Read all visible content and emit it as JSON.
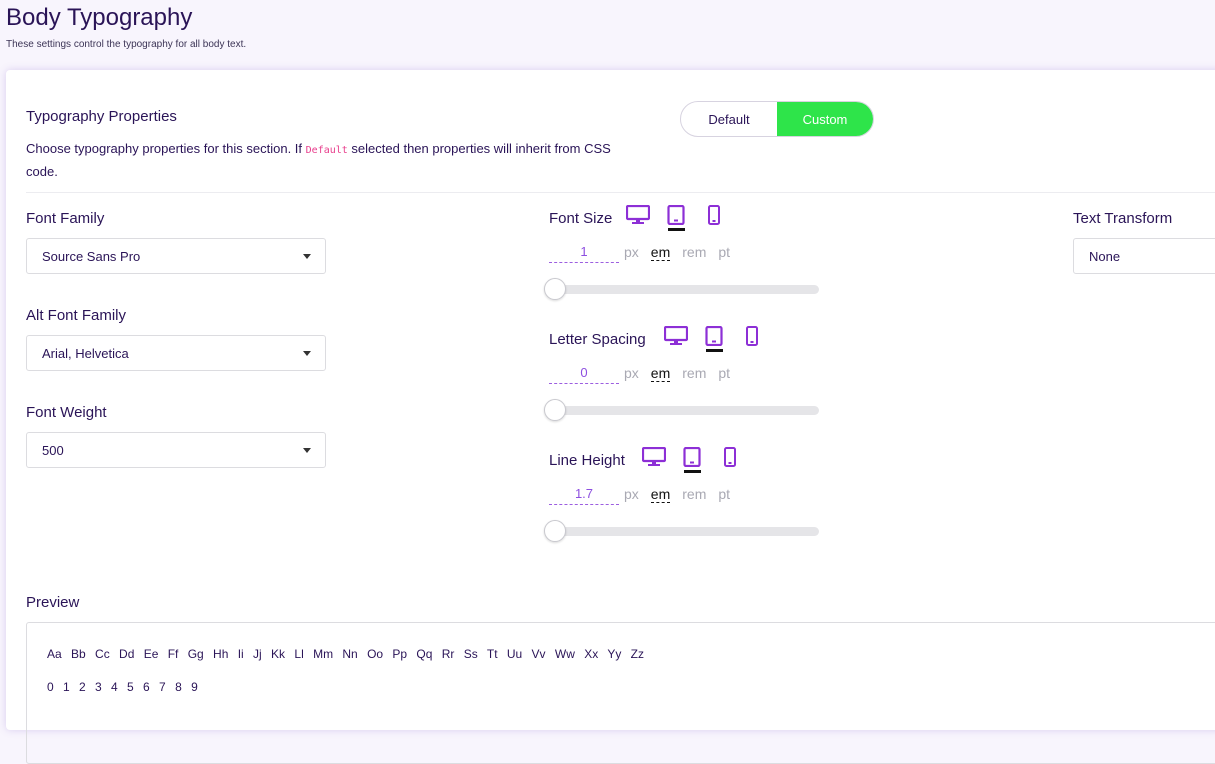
{
  "page": {
    "title": "Body Typography",
    "description": "These settings control the typography for all body text."
  },
  "section": {
    "title": "Typography Properties",
    "desc_before": "Choose typography properties for this section. If ",
    "desc_code": "Default",
    "desc_after": " selected then properties will inherit from CSS code."
  },
  "mode_toggle": {
    "options": [
      "Default",
      "Custom"
    ],
    "selected": "Custom"
  },
  "font_family": {
    "label": "Font Family",
    "value": "Source Sans Pro"
  },
  "alt_font_family": {
    "label": "Alt Font Family",
    "value": "Arial, Helvetica"
  },
  "font_weight": {
    "label": "Font Weight",
    "value": "500"
  },
  "text_transform": {
    "label": "Text Transform",
    "value": "None"
  },
  "font_size": {
    "label": "Font Size",
    "value": "1",
    "active_device": "tablet",
    "active_unit": "em",
    "slider_fraction": 0.0
  },
  "letter_spacing": {
    "label": "Letter Spacing",
    "value": "0",
    "active_device": "tablet",
    "active_unit": "em",
    "slider_fraction": 0.0
  },
  "line_height": {
    "label": "Line Height",
    "value": "1.7",
    "active_device": "tablet",
    "active_unit": "em",
    "slider_fraction": 0.0
  },
  "units": [
    "px",
    "em",
    "rem",
    "pt"
  ],
  "devices": [
    "desktop-icon",
    "tablet-icon",
    "mobile-icon"
  ],
  "preview": {
    "label": "Preview",
    "letters": "Aa Bb Cc Dd Ee Ff Gg Hh Ii Jj Kk Ll Mm Nn Oo Pp Qq Rr Ss Tt Uu Vv Ww Xx Yy Zz",
    "digits": "0 1 2 3 4 5 6 7 8 9"
  },
  "colors": {
    "accent": "#8d2fd6",
    "toggle_active": "#2ee44a",
    "heading": "#2a1457"
  }
}
